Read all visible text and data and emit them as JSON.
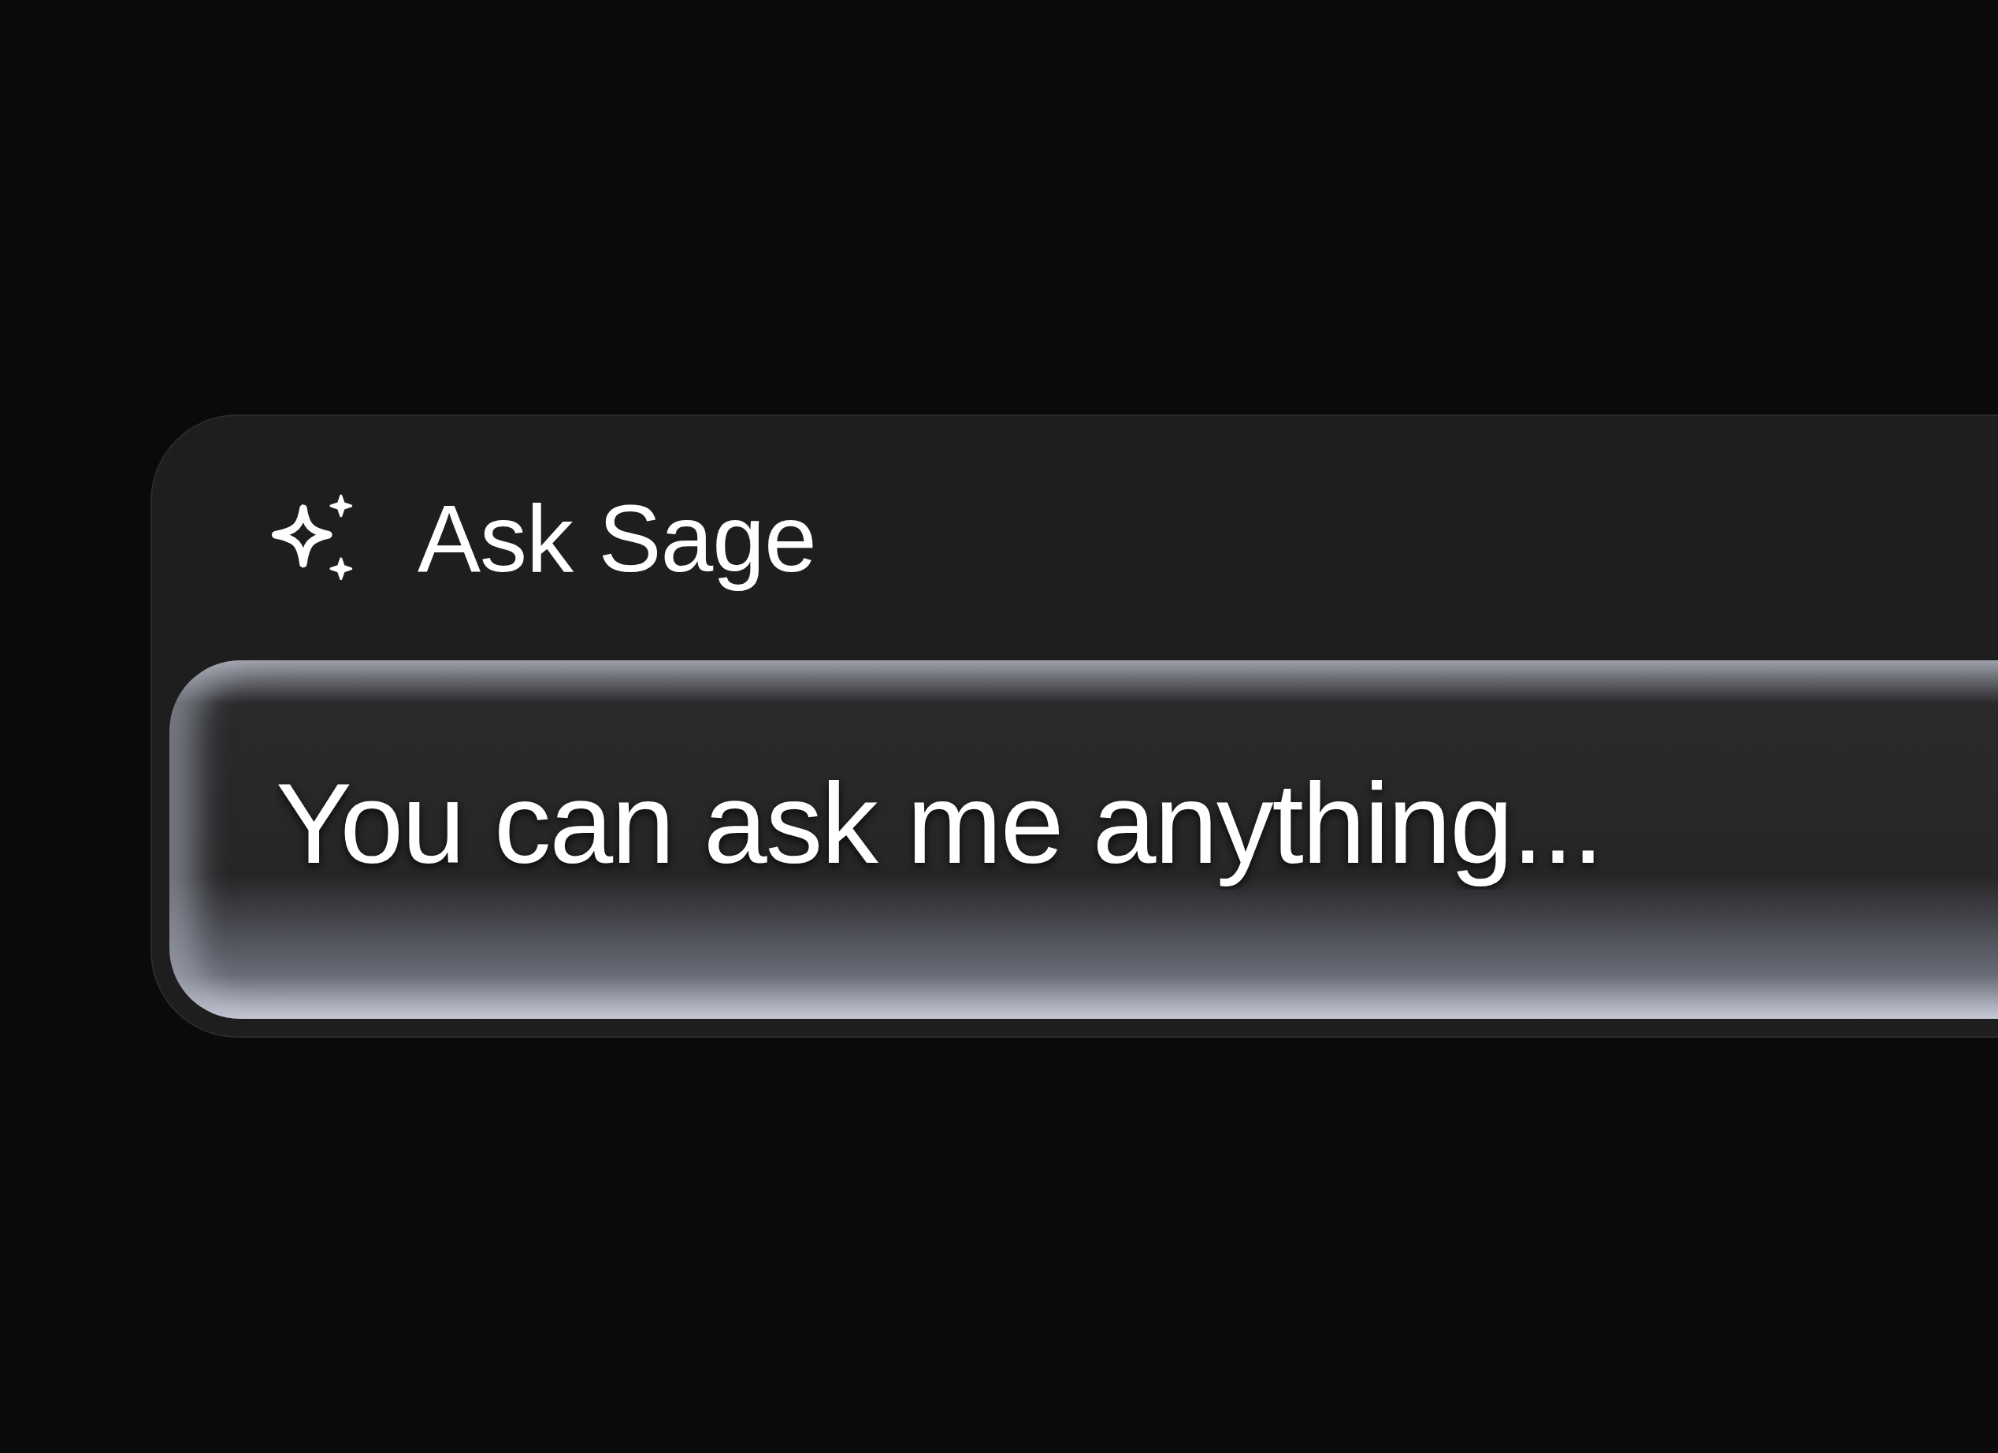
{
  "assistant": {
    "title": "Ask Sage"
  },
  "prompt": {
    "placeholder": "You can ask me anything..."
  }
}
